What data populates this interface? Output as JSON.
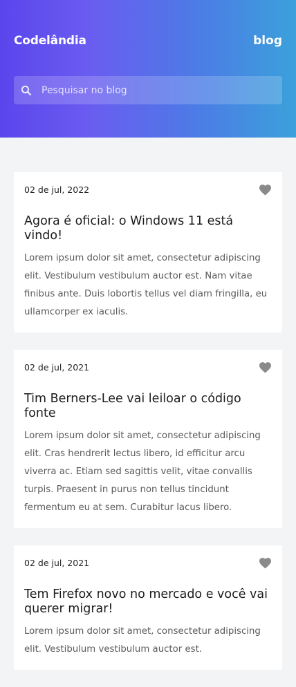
{
  "header": {
    "brand": "Codelândia",
    "nav_label": "blog",
    "search_placeholder": "Pesquisar no blog"
  },
  "colors": {
    "gradient_start": "#5a45ec",
    "gradient_end": "#3ba1db",
    "background": "#f3f4f6",
    "heart": "#8a8a8a"
  },
  "icons": {
    "search": "search-icon",
    "like": "heart-icon"
  },
  "posts": [
    {
      "date": "02 de jul, 2022",
      "title": "Agora é oficial: o Windows 11 está vindo!",
      "excerpt": "Lorem ipsum dolor sit amet, consectetur adipiscing elit. Vestibulum vestibulum auctor est. Nam vitae finibus ante. Duis lobortis tellus vel diam fringilla, eu ullamcorper ex iaculis."
    },
    {
      "date": "02 de jul, 2021",
      "title": "Tim Berners-Lee vai leiloar o código fonte",
      "excerpt": "Lorem ipsum dolor sit amet, consectetur adipiscing elit. Cras hendrerit lectus libero, id efficitur arcu viverra ac. Etiam sed sagittis velit, vitae convallis turpis. Praesent in purus non tellus tincidunt fermentum eu at sem. Curabitur lacus libero."
    },
    {
      "date": "02 de jul, 2021",
      "title": "Tem Firefox novo no mercado e você vai querer migrar!",
      "excerpt": "Lorem ipsum dolor sit amet, consectetur adipiscing elit. Vestibulum vestibulum auctor est."
    }
  ]
}
